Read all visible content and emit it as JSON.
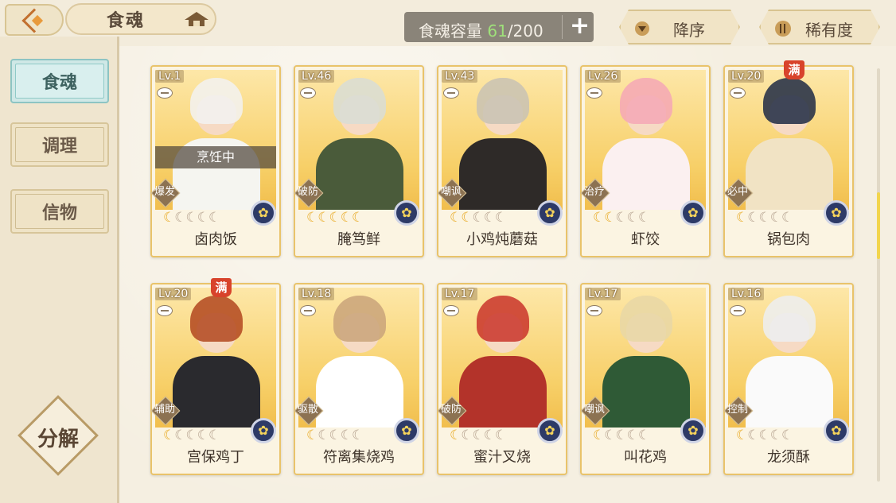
{
  "header": {
    "title": "食魂",
    "capacity_label": "食魂容量",
    "capacity_current": "61",
    "capacity_max": "/200",
    "plus": "+",
    "sort_order": "降序",
    "sort_by": "稀有度"
  },
  "sidebar": {
    "items": [
      {
        "label": "食魂",
        "active": true
      },
      {
        "label": "调理",
        "active": false
      },
      {
        "label": "信物",
        "active": false
      }
    ],
    "decompose_label": "分解"
  },
  "status_texts": {
    "busy": "烹饪中",
    "maxed": "满"
  },
  "cards": [
    {
      "level": "Lv.1",
      "name": "卤肉饭",
      "role": "爆发",
      "stars_lit": 1,
      "stars_total": 5,
      "busy": true,
      "maxed": false,
      "hair": "#f2f2f2",
      "outfit": "#f5f5f0"
    },
    {
      "level": "Lv.46",
      "name": "腌笃鲜",
      "role": "破防",
      "stars_lit": 5,
      "stars_total": 5,
      "busy": false,
      "maxed": false,
      "hair": "#d8ddd6",
      "outfit": "#4a5b3a"
    },
    {
      "level": "Lv.43",
      "name": "小鸡炖蘑菇",
      "role": "嘲讽",
      "stars_lit": 2,
      "stars_total": 5,
      "busy": false,
      "maxed": false,
      "hair": "#c8c2b4",
      "outfit": "#2e2a28"
    },
    {
      "level": "Lv.26",
      "name": "虾饺",
      "role": "治疗",
      "stars_lit": 2,
      "stars_total": 5,
      "busy": false,
      "maxed": false,
      "hair": "#f4a7b6",
      "outfit": "#fbf0f0"
    },
    {
      "level": "Lv.20",
      "name": "锅包肉",
      "role": "必中",
      "stars_lit": 1,
      "stars_total": 5,
      "busy": false,
      "maxed": true,
      "hair": "#1f2a44",
      "outfit": "#f1e3c4"
    },
    {
      "level": "Lv.20",
      "name": "宫保鸡丁",
      "role": "辅助",
      "stars_lit": 1,
      "stars_total": 5,
      "busy": false,
      "maxed": true,
      "hair": "#b1461e",
      "outfit": "#2a2a2e"
    },
    {
      "level": "Lv.18",
      "name": "符离集烧鸡",
      "role": "驱散",
      "stars_lit": 1,
      "stars_total": 5,
      "busy": false,
      "maxed": false,
      "hair": "#c9a37a",
      "outfit": "#ffffff"
    },
    {
      "level": "Lv.17",
      "name": "蜜汁叉烧",
      "role": "破防",
      "stars_lit": 1,
      "stars_total": 5,
      "busy": false,
      "maxed": false,
      "hair": "#c9342a",
      "outfit": "#b3332a"
    },
    {
      "level": "Lv.17",
      "name": "叫花鸡",
      "role": "嘲讽",
      "stars_lit": 1,
      "stars_total": 5,
      "busy": false,
      "maxed": false,
      "hair": "#e7d7a6",
      "outfit": "#2f5a36"
    },
    {
      "level": "Lv.16",
      "name": "龙须酥",
      "role": "控制",
      "stars_lit": 1,
      "stars_total": 5,
      "busy": false,
      "maxed": false,
      "hair": "#eceef2",
      "outfit": "#fafafa"
    }
  ],
  "colors": {
    "accent_gold": "#e9c36a",
    "capacity_highlight": "#9fe07a",
    "active_tab": "#cfe8e6"
  }
}
